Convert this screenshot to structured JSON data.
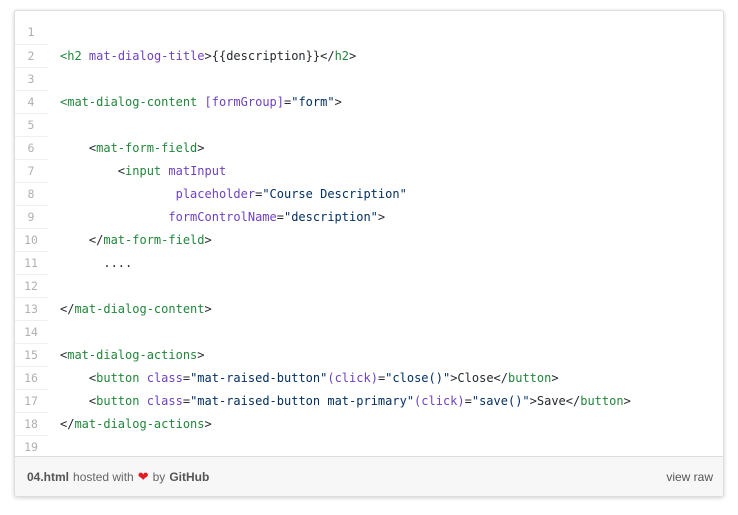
{
  "gist": {
    "lines": [
      {
        "n": "1",
        "tokens": []
      },
      {
        "n": "2",
        "tokens": [
          [
            "tag",
            "<h2"
          ],
          [
            "txt",
            " "
          ],
          [
            "attr",
            "mat-dialog-title"
          ],
          [
            "txt",
            ">{{description}}</"
          ],
          [
            "tag",
            "h2"
          ],
          [
            "txt",
            ">"
          ]
        ]
      },
      {
        "n": "3",
        "tokens": []
      },
      {
        "n": "4",
        "tokens": [
          [
            "tag",
            "<mat-dialog-content"
          ],
          [
            "txt",
            " "
          ],
          [
            "attr",
            "[formGroup]"
          ],
          [
            "txt",
            "="
          ],
          [
            "str",
            "\"form\""
          ],
          [
            "txt",
            ">"
          ]
        ]
      },
      {
        "n": "5",
        "tokens": []
      },
      {
        "n": "6",
        "tokens": [
          [
            "txt",
            "    <"
          ],
          [
            "tag",
            "mat-form-field"
          ],
          [
            "txt",
            ">"
          ]
        ]
      },
      {
        "n": "7",
        "tokens": [
          [
            "txt",
            "        <"
          ],
          [
            "tag",
            "input"
          ],
          [
            "txt",
            " "
          ],
          [
            "attr",
            "matInput"
          ]
        ]
      },
      {
        "n": "8",
        "tokens": [
          [
            "txt",
            "                "
          ],
          [
            "attr",
            "placeholder"
          ],
          [
            "txt",
            "="
          ],
          [
            "str",
            "\"Course Description\""
          ]
        ]
      },
      {
        "n": "9",
        "tokens": [
          [
            "txt",
            "               "
          ],
          [
            "attr",
            "formControlName"
          ],
          [
            "txt",
            "="
          ],
          [
            "str",
            "\"description\""
          ],
          [
            "txt",
            ">"
          ]
        ]
      },
      {
        "n": "10",
        "tokens": [
          [
            "txt",
            "    </"
          ],
          [
            "tag",
            "mat-form-field"
          ],
          [
            "txt",
            ">"
          ]
        ]
      },
      {
        "n": "11",
        "tokens": [
          [
            "txt",
            "      ...."
          ]
        ]
      },
      {
        "n": "12",
        "tokens": []
      },
      {
        "n": "13",
        "tokens": [
          [
            "txt",
            "</"
          ],
          [
            "tag",
            "mat-dialog-content"
          ],
          [
            "txt",
            ">"
          ]
        ]
      },
      {
        "n": "14",
        "tokens": []
      },
      {
        "n": "15",
        "tokens": [
          [
            "txt",
            "<"
          ],
          [
            "tag",
            "mat-dialog-actions"
          ],
          [
            "txt",
            ">"
          ]
        ]
      },
      {
        "n": "16",
        "tokens": [
          [
            "txt",
            "    <"
          ],
          [
            "tag",
            "button"
          ],
          [
            "txt",
            " "
          ],
          [
            "attr",
            "class"
          ],
          [
            "txt",
            "="
          ],
          [
            "str",
            "\"mat-raised-button\""
          ],
          [
            "attr",
            "(click)"
          ],
          [
            "txt",
            "="
          ],
          [
            "str",
            "\"close()\""
          ],
          [
            "txt",
            ">Close</"
          ],
          [
            "tag",
            "button"
          ],
          [
            "txt",
            ">"
          ]
        ]
      },
      {
        "n": "17",
        "tokens": [
          [
            "txt",
            "    <"
          ],
          [
            "tag",
            "button"
          ],
          [
            "txt",
            " "
          ],
          [
            "attr",
            "class"
          ],
          [
            "txt",
            "="
          ],
          [
            "str",
            "\"mat-raised-button mat-primary\""
          ],
          [
            "attr",
            "(click)"
          ],
          [
            "txt",
            "="
          ],
          [
            "str",
            "\"save()\""
          ],
          [
            "txt",
            ">Save</"
          ],
          [
            "tag",
            "button"
          ],
          [
            "txt",
            ">"
          ]
        ]
      },
      {
        "n": "18",
        "tokens": [
          [
            "txt",
            "</"
          ],
          [
            "tag",
            "mat-dialog-actions"
          ],
          [
            "txt",
            ">"
          ]
        ]
      },
      {
        "n": "19",
        "tokens": []
      }
    ]
  },
  "footer": {
    "file_name": "04.html",
    "hosted_with": "hosted with",
    "heart": "❤",
    "by": "by",
    "provider": "GitHub",
    "view_raw": "view raw"
  },
  "colors": {
    "tag": "#22863a",
    "attr": "#6f42c1",
    "string": "#032f62",
    "heart": "#e31b23"
  }
}
